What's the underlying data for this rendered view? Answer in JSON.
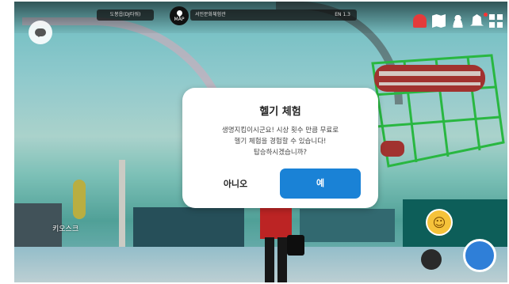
{
  "hud": {
    "location_tab": "도봉읍(DJ타워)",
    "map_label": "MAP",
    "place_name": "서민문화체험관",
    "channel": "EN 1.3",
    "kiosk_label": "키오스크"
  },
  "dialog": {
    "title": "헬기 체험",
    "message_line1": "생명지킴이시군요! 시상 횟수 만큼 무료로",
    "message_line2": "헬기 체험을 경험할 수 있습니다!",
    "message_line3": "탑승하시겠습니까?",
    "no_label": "아니오",
    "yes_label": "예"
  },
  "colors": {
    "primary_button": "#1a82d6",
    "alert_red": "#e43b3b",
    "heli_green": "#2fd14a",
    "heli_red": "#b83a36"
  },
  "icons": [
    "chat-icon",
    "map-pin-icon",
    "siren-icon",
    "map-icon",
    "person-icon",
    "bell-icon",
    "grid-icon",
    "smile-icon",
    "camera-icon",
    "hand-icon"
  ]
}
